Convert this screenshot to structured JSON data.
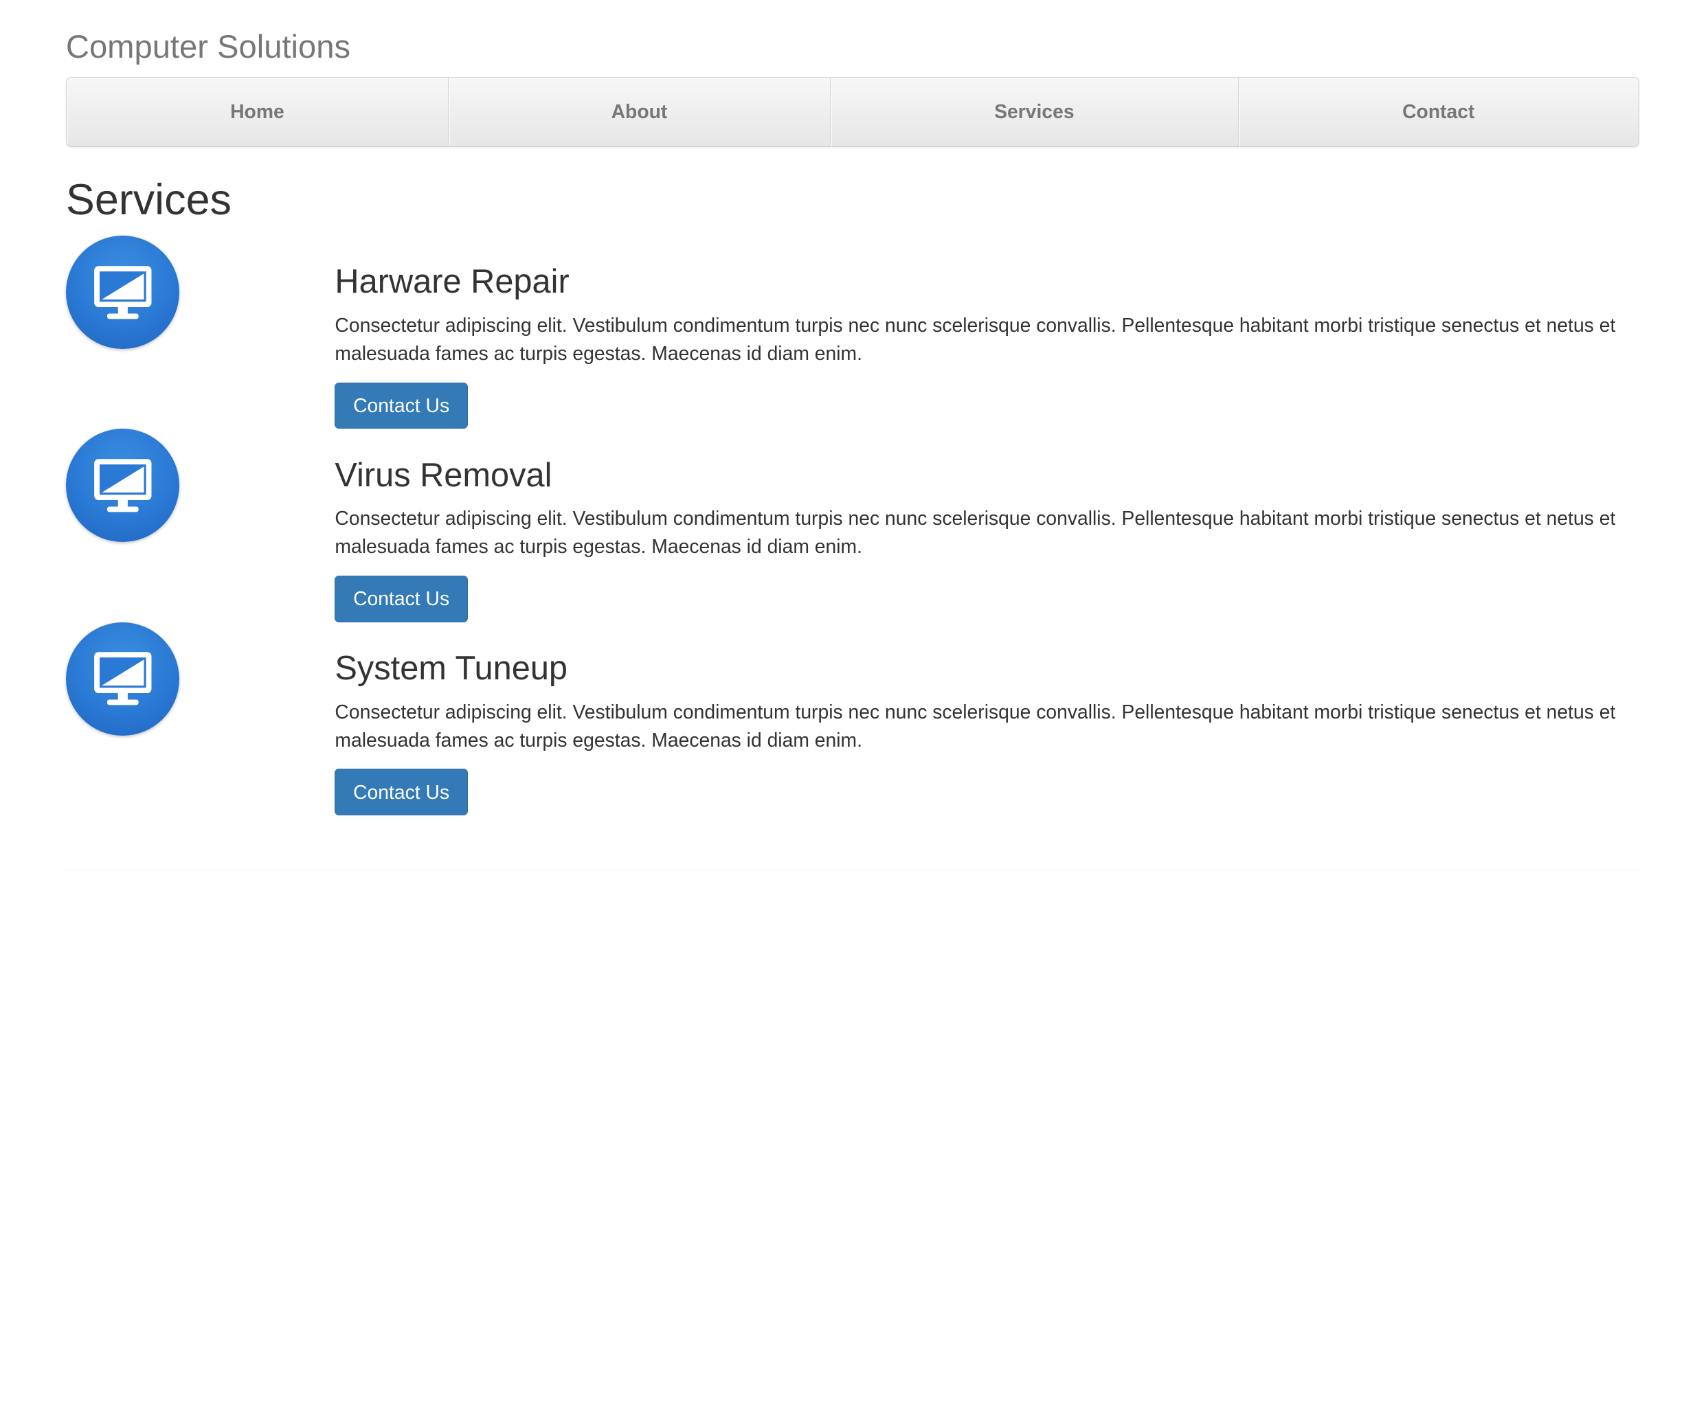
{
  "brand": "Computer Solutions",
  "nav": {
    "items": [
      {
        "label": "Home"
      },
      {
        "label": "About"
      },
      {
        "label": "Services"
      },
      {
        "label": "Contact"
      }
    ]
  },
  "page_title": "Services",
  "services": [
    {
      "title": "Harware Repair",
      "description": "Consectetur adipiscing elit. Vestibulum condimentum turpis nec nunc scelerisque convallis. Pellentesque habitant morbi tristique senectus et netus et malesuada fames ac turpis egestas. Maecenas id diam enim.",
      "button_label": "Contact Us",
      "icon": "monitor-icon"
    },
    {
      "title": "Virus Removal",
      "description": "Consectetur adipiscing elit. Vestibulum condimentum turpis nec nunc scelerisque convallis. Pellentesque habitant morbi tristique senectus et netus et malesuada fames ac turpis egestas. Maecenas id diam enim.",
      "button_label": "Contact Us",
      "icon": "monitor-icon"
    },
    {
      "title": "System Tuneup",
      "description": "Consectetur adipiscing elit. Vestibulum condimentum turpis nec nunc scelerisque convallis. Pellentesque habitant morbi tristique senectus et netus et malesuada fames ac turpis egestas. Maecenas id diam enim.",
      "button_label": "Contact Us",
      "icon": "monitor-icon"
    }
  ],
  "colors": {
    "primary_button": "#337ab7",
    "icon_circle": "#2a79d4",
    "brand_text": "#777777"
  }
}
